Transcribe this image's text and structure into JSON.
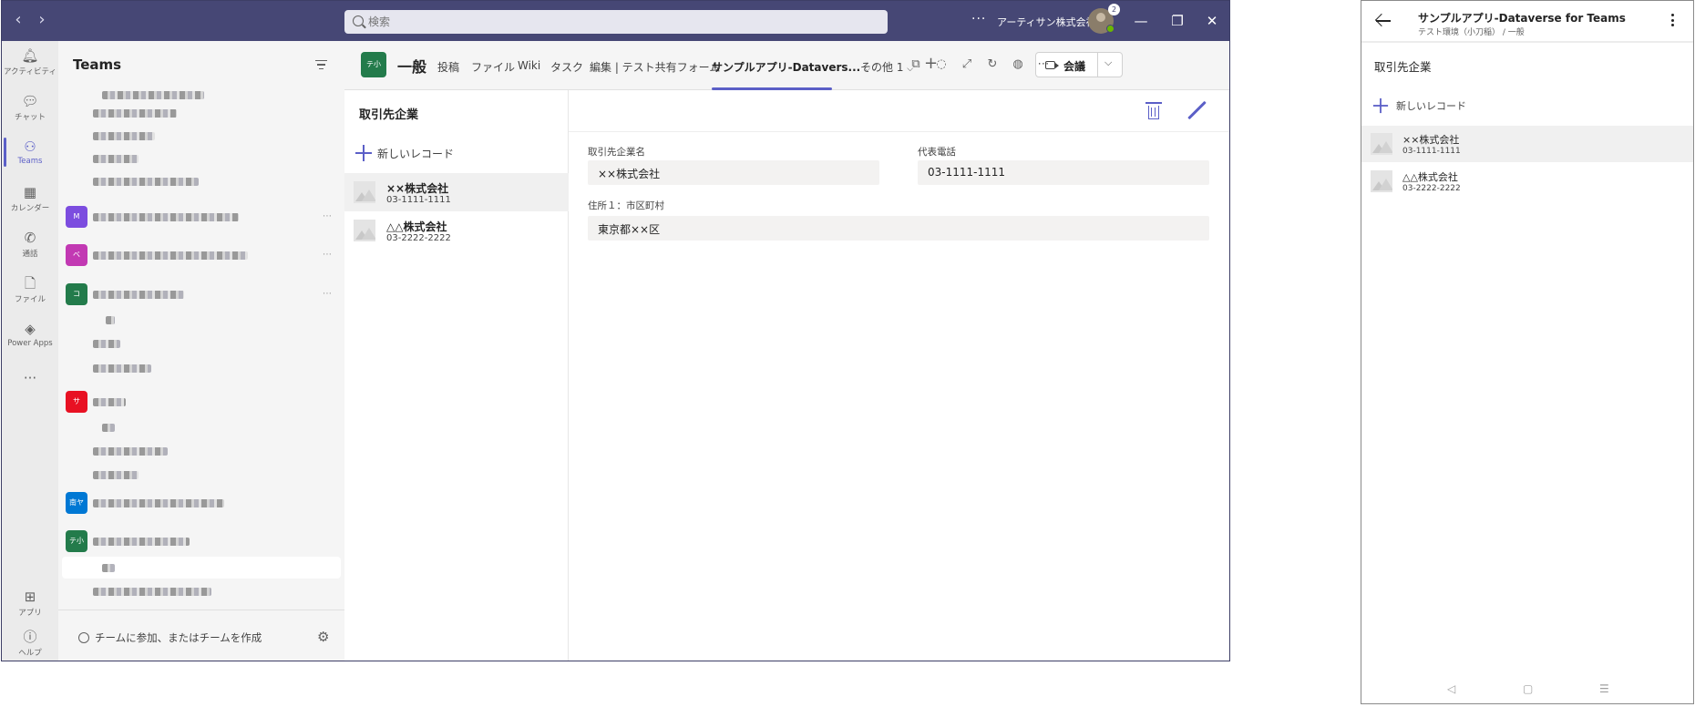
{
  "window": {
    "search_placeholder": "検索",
    "more": "···",
    "org_name": "アーティサン株式会社",
    "notification_count": "2"
  },
  "app_bar": [
    {
      "name": "activity",
      "label": "アクティビティ",
      "icon": "bell-icon"
    },
    {
      "name": "chat",
      "label": "チャット",
      "icon": "chat-icon"
    },
    {
      "name": "teams",
      "label": "Teams",
      "icon": "teams-icon",
      "active": true
    },
    {
      "name": "calendar",
      "label": "カレンダー",
      "icon": "calendar-icon"
    },
    {
      "name": "calls",
      "label": "通話",
      "icon": "phone-icon"
    },
    {
      "name": "files",
      "label": "ファイル",
      "icon": "file-icon"
    },
    {
      "name": "power-apps",
      "label": "Power Apps",
      "icon": "power-apps-icon"
    },
    {
      "name": "apps",
      "label": "アプリ",
      "icon": "apps-icon"
    },
    {
      "name": "help",
      "label": "ヘルプ",
      "icon": "help-icon"
    }
  ],
  "teams_panel": {
    "title": "Teams",
    "team_initials": [
      "M",
      "ベ",
      "コ",
      "サ",
      "南ヤ",
      "テ小"
    ],
    "join_label": "チームに参加、またはチームを作成"
  },
  "channel": {
    "avatar_text": "テ小",
    "name": "一般",
    "tabs": [
      "投稿",
      "ファイル",
      "Wiki",
      "タスク",
      "編集 | テスト共有フォーム",
      "サンプルアプリ-Datavers...",
      "その他 1"
    ],
    "add_tab": "+",
    "meet_label": "会議"
  },
  "app": {
    "list_title": "取引先企業",
    "new_record_label": "新しいレコード",
    "records": [
      {
        "name": "××株式会社",
        "phone": "03-1111-1111"
      },
      {
        "name": "△△株式会社",
        "phone": "03-2222-2222"
      }
    ],
    "detail": {
      "company_label": "取引先企業名",
      "company_value": "××株式会社",
      "phone_label": "代表電話",
      "phone_value": "03-1111-1111",
      "address_label": "住所１：市区町村",
      "address_value": "東京都××区"
    }
  },
  "mobile": {
    "title": "サンプルアプリ-Dataverse for Teams",
    "subtitle": "テスト環境（小刀稲） / 一般",
    "list_title": "取引先企業",
    "new_record_label": "新しいレコード",
    "records": [
      {
        "name": "××株式会社",
        "phone": "03-1111-1111"
      },
      {
        "name": "△△株式会社",
        "phone": "03-2222-2222"
      }
    ],
    "softkeys": [
      "◁",
      "▢",
      "☰"
    ]
  },
  "colors": {
    "titlebar": "#464775",
    "accent": "#5b5fc7",
    "team_avatar_colors": [
      "#7c4ddf",
      "#c239b3",
      "#237b4b",
      "#e81123",
      "#0078d4",
      "#237b4b"
    ]
  }
}
